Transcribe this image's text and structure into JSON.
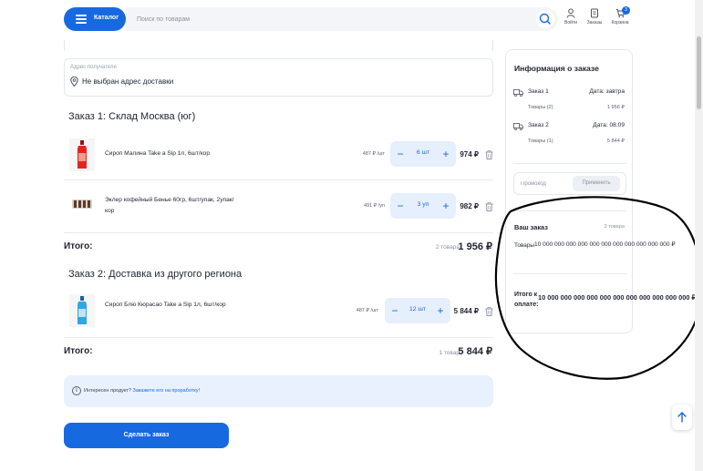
{
  "header": {
    "catalog_label": "Каталог",
    "search_placeholder": "Поиск по товарам",
    "nav": [
      {
        "label": "Войти",
        "icon": "user-icon"
      },
      {
        "label": "Заказы",
        "icon": "orders-icon"
      },
      {
        "label": "Корзина",
        "icon": "cart-icon",
        "badge": "3"
      }
    ]
  },
  "address": {
    "label": "Адрес получателя",
    "value": "Не выбран адрес доставки"
  },
  "orders": [
    {
      "title": "Заказ 1: Склад Москва (юг)",
      "items": [
        {
          "name": "Сироп Малина Take a Sip 1л, 6шт/кор",
          "price": "487 ₽ /шт",
          "qty": "6 шт",
          "sum": "974 ₽",
          "image": "red-syrup-bottle"
        },
        {
          "name": "Эклер кофейный Беньe 60гр, 6шт/упак, 2упак/кор",
          "price": "491 ₽ /уп",
          "qty": "3 уп",
          "sum": "982 ₽",
          "image": "eclair-pack"
        }
      ],
      "total_label": "Итого:",
      "total_count": "2 товара",
      "total_sum": "1 956 ₽"
    },
    {
      "title": "Заказ 2: Доставка из другого региона",
      "items": [
        {
          "name": "Сироп Блю Кюрасао Take a Sip 1л, 6шт/кор",
          "price": "487 ₽ /шт",
          "qty": "12 шт",
          "sum": "5 844 ₽",
          "image": "blue-syrup-bottle"
        }
      ],
      "total_label": "Итого:",
      "total_count": "1 товар",
      "total_sum": "5 844 ₽"
    }
  ],
  "banner": {
    "text": "Интересен продукт?",
    "link": "Закажите его на проработку!"
  },
  "order_button": "Сделать заказ",
  "summary": {
    "title": "Информация о заказе",
    "shipments": [
      {
        "label": "Заказ 1",
        "date": "Дата: завтра",
        "goods_label": "Товары (2)",
        "goods_sum": "1 956 ₽"
      },
      {
        "label": "Заказ 2",
        "date": "Дата: 08.09",
        "goods_label": "Товары (1)",
        "goods_sum": "5 844 ₽"
      }
    ],
    "promo_placeholder": "Промокод",
    "promo_apply": "Применить",
    "your_order": "Ваш заказ",
    "your_count": "3 товара",
    "goods_label": "Товары",
    "goods_value": "10 000 000 000 000 000 000 000 000 000 000 000 ₽",
    "pay_label": "Итого к оплате:",
    "pay_value": "10 000 000 000 000 000 000 000 000 000 000 000 ₽"
  },
  "colors": {
    "accent": "#1769e0",
    "stepper_bg": "#e6effc",
    "banner_bg": "#e8f1fd",
    "annotation": "#000000"
  }
}
